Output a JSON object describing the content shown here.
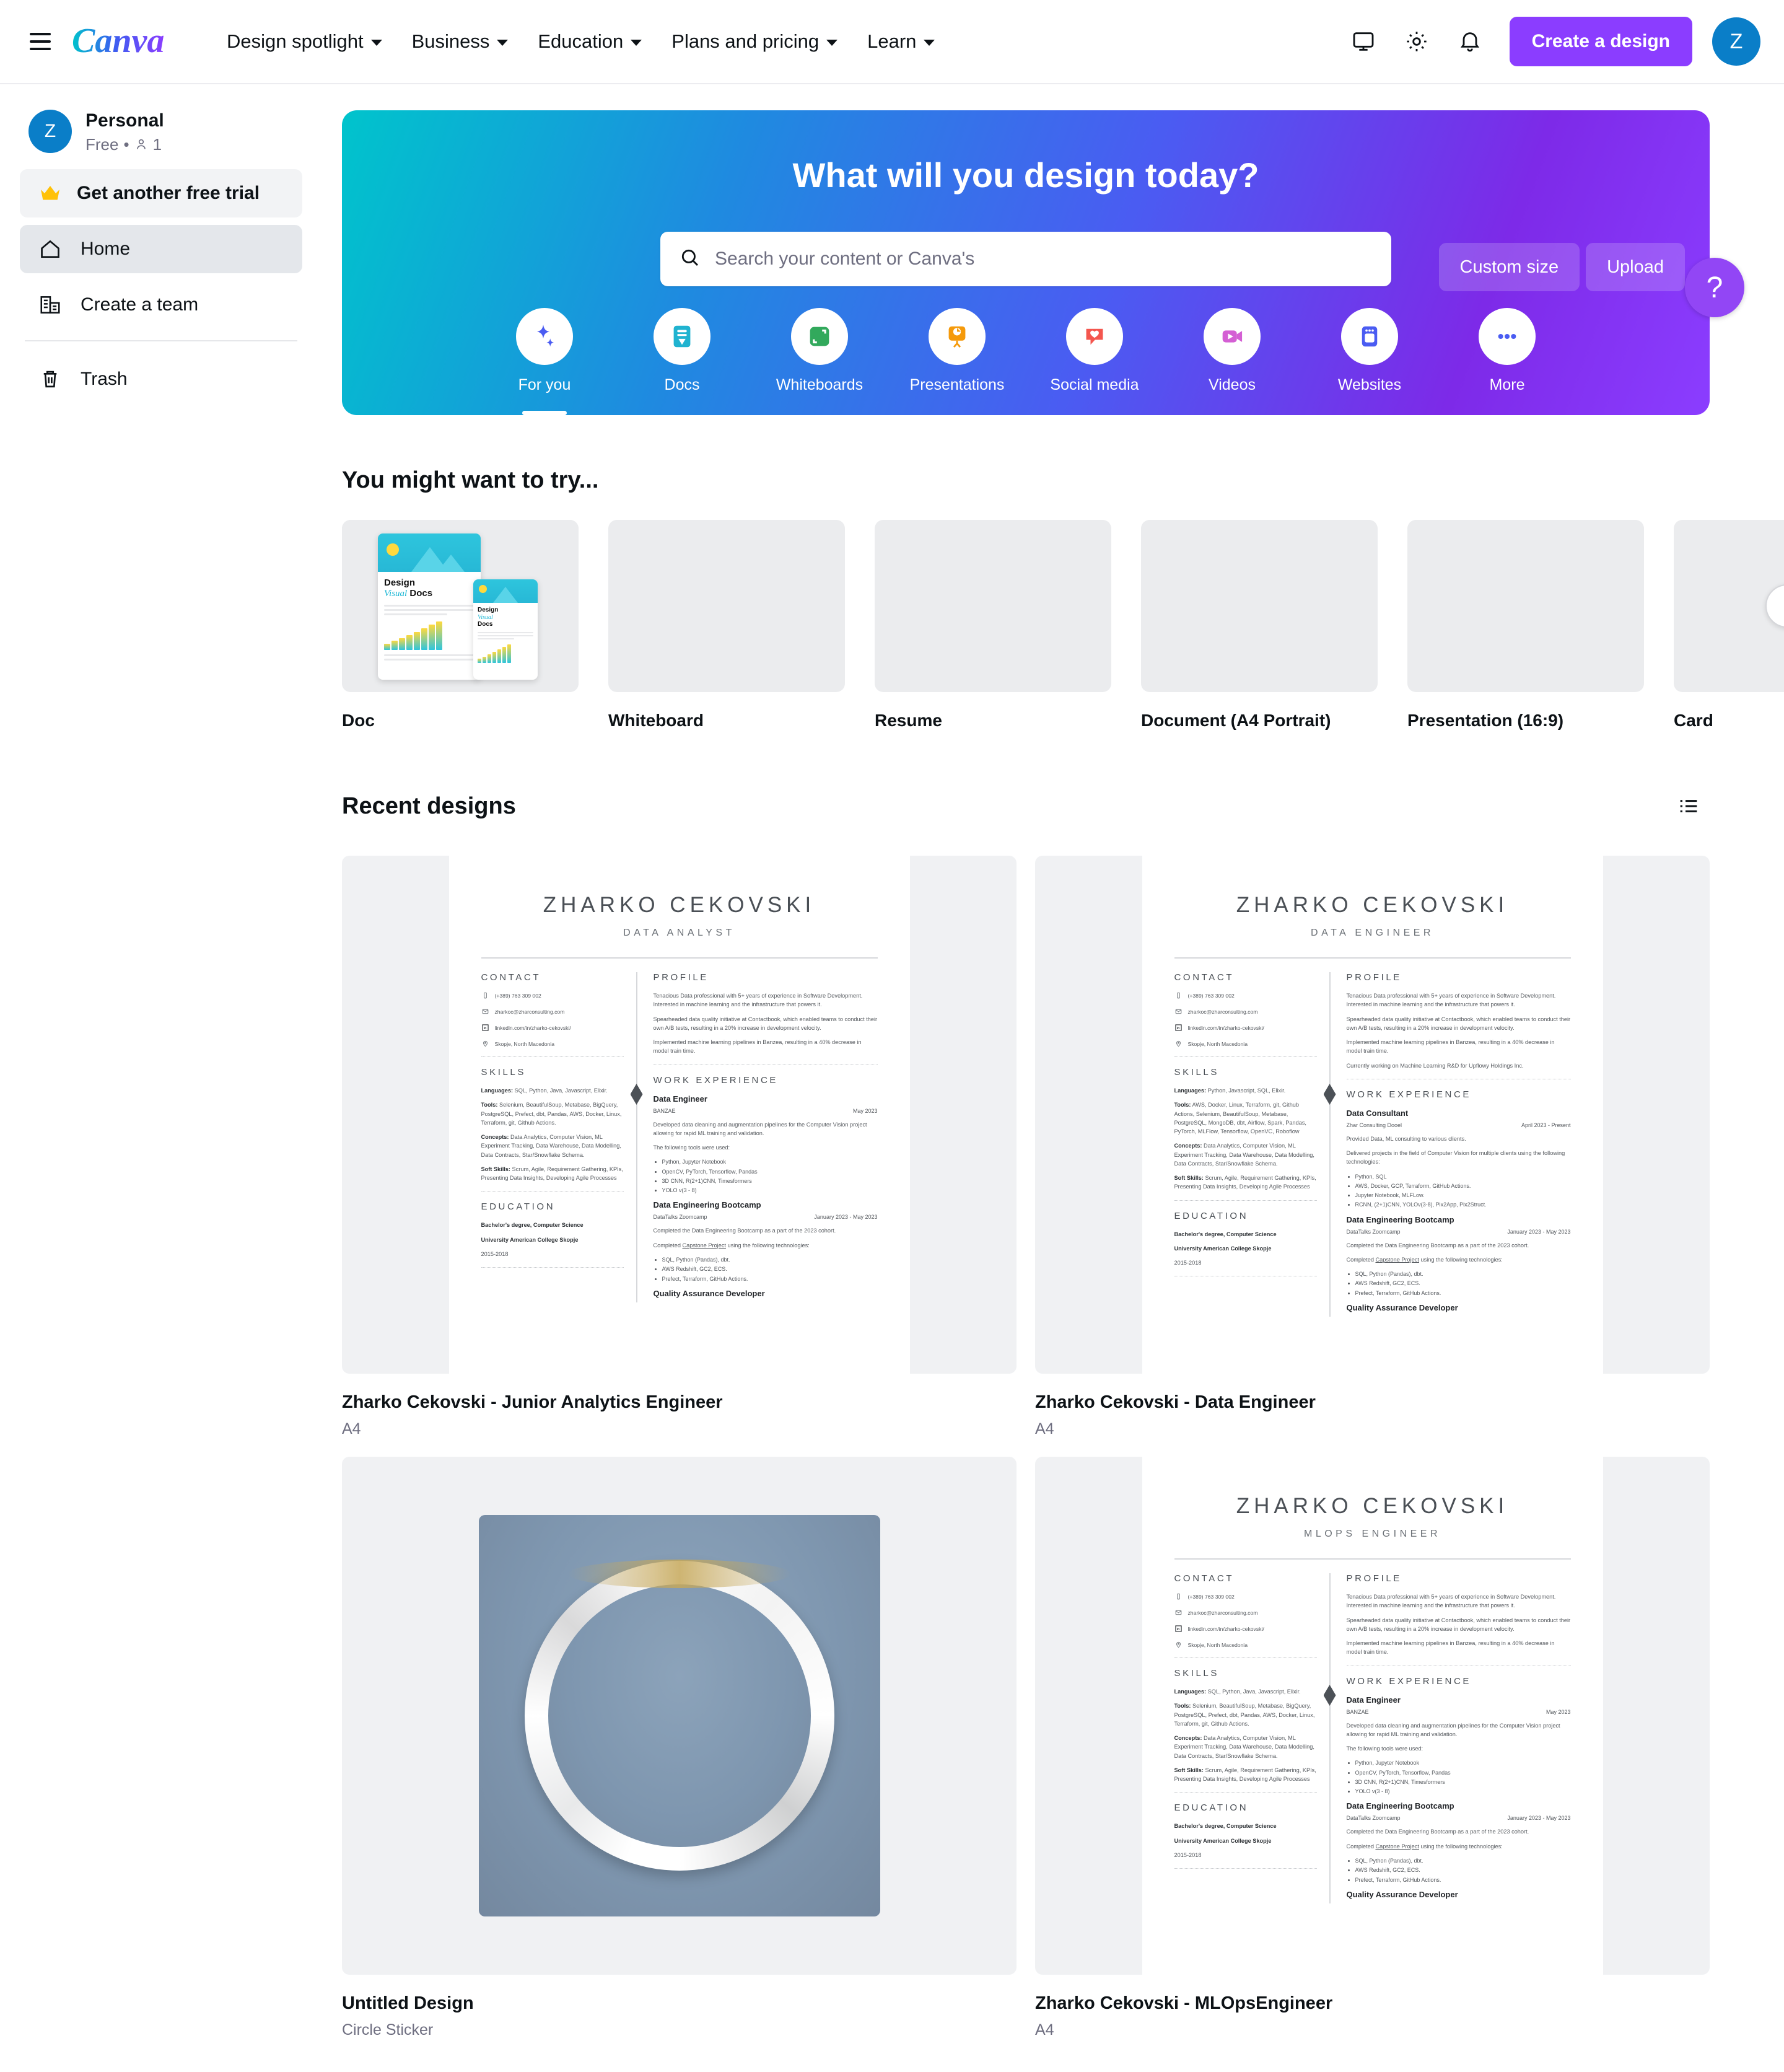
{
  "topnav": {
    "brand": "Canva",
    "menu_icon": "hamburger-icon",
    "links": [
      {
        "label": "Design spotlight"
      },
      {
        "label": "Business"
      },
      {
        "label": "Education"
      },
      {
        "label": "Plans and pricing"
      },
      {
        "label": "Learn"
      }
    ],
    "icons": [
      {
        "name": "monitor-icon"
      },
      {
        "name": "gear-icon"
      },
      {
        "name": "bell-icon"
      }
    ],
    "create_label": "Create a design",
    "avatar_initial": "Z",
    "accent_purple": "#8b3dff",
    "avatar_blue": "#0a7ec8"
  },
  "sidebar": {
    "account": {
      "initial": "Z",
      "name": "Personal",
      "plan": "Free",
      "separator": "•",
      "member_count": "1"
    },
    "items": [
      {
        "label": "Get another free trial",
        "icon": "crown-icon"
      },
      {
        "label": "Home",
        "icon": "home-icon"
      },
      {
        "label": "Create a team",
        "icon": "building-icon"
      },
      {
        "label": "Trash",
        "icon": "trash-icon"
      }
    ]
  },
  "hero": {
    "title": "What will you design today?",
    "custom_size_label": "Custom size",
    "upload_label": "Upload",
    "search_placeholder": "Search your content or Canva's",
    "search_value": "",
    "search_icon": "search-icon",
    "help_label": "?",
    "categories": [
      {
        "label": "For you",
        "icon": "sparkle-icon",
        "color": "#ffffff",
        "selected": true
      },
      {
        "label": "Docs",
        "icon": "doc-icon",
        "color": "#20b3d0",
        "selected": false
      },
      {
        "label": "Whiteboards",
        "icon": "whiteboard-icon",
        "color": "#32a95c",
        "selected": false
      },
      {
        "label": "Presentations",
        "icon": "presentation-icon",
        "color": "#f59a0b",
        "selected": false
      },
      {
        "label": "Social media",
        "icon": "heart-bubble-icon",
        "color": "#f4564e",
        "selected": false
      },
      {
        "label": "Videos",
        "icon": "video-icon",
        "color": "#d45fd4",
        "selected": false
      },
      {
        "label": "Websites",
        "icon": "website-icon",
        "color": "#4a5cf2",
        "selected": false
      },
      {
        "label": "More",
        "icon": "ellipsis-icon",
        "color": "#4a5cf2",
        "selected": false
      }
    ]
  },
  "try_section": {
    "title": "You might want to try...",
    "next_icon": "chevron-right-icon",
    "cards": [
      {
        "label": "Doc",
        "has_preview": true,
        "preview_title_1": "Design",
        "preview_title_2": "Visual",
        "preview_title_3": "Docs"
      },
      {
        "label": "Whiteboard",
        "has_preview": false
      },
      {
        "label": "Resume",
        "has_preview": false
      },
      {
        "label": "Document (A4 Portrait)",
        "has_preview": false
      },
      {
        "label": "Presentation (16:9)",
        "has_preview": false
      },
      {
        "label": "Card",
        "has_preview": false
      }
    ]
  },
  "recent_section": {
    "title": "Recent designs",
    "layout_icon": "list-view-icon",
    "designs": [
      {
        "title": "Zharko Cekovski - Junior Analytics Engineer",
        "meta": "A4",
        "kind": "resume",
        "role": "DATA ANALYST"
      },
      {
        "title": "Zharko Cekovski - Data Engineer",
        "meta": "A4",
        "kind": "resume",
        "role": "DATA ENGINEER"
      },
      {
        "title": "Untitled Design",
        "meta": "Circle Sticker",
        "kind": "sticker"
      },
      {
        "title": " Zharko Cekovski - MLOpsEngineer",
        "meta": "A4",
        "kind": "resume",
        "role": "MLOPS ENGINEER"
      }
    ]
  },
  "resume_common": {
    "name": "ZHARKO CEKOVSKI",
    "contact_heading": "CONTACT",
    "profile_heading": "PROFILE",
    "skills_heading": "SKILLS",
    "work_heading": "WORK EXPERIENCE",
    "education_heading": "EDUCATION",
    "phone": "(+389) 763 309 002",
    "email": "zharkoc@zharconsulting.com",
    "linkedin": "linkedin.com/in/zharko-cekovski/",
    "location": "Skopje, North Macedonia",
    "profile_p1": "Tenacious Data professional with 5+ years of experience in Software Development. Interested in machine learning and the infrastructure that powers it.",
    "profile_p2": "Spearheaded data quality initiative at Contactbook, which enabled teams to conduct their own A/B tests, resulting in a 20% increase in development velocity.",
    "profile_p3": "Implemented machine learning pipelines in Banzea, resulting in a 40% decrease in model train time.",
    "profile_p4": "Currently working on Machine Learning R&D for Upflowy Holdings Inc.",
    "skills_lang_label": "Languages:",
    "skills_lang_a": "SQL, Python, Java, Javascript, Elixir.",
    "skills_lang_b": "Python, Javascript, SQL, Elixir.",
    "skills_tools_label": "Tools:",
    "skills_tools_a": "Selenium, BeautifulSoup, Metabase, BigQuery, PostgreSQL, Prefect, dbt, Pandas, AWS, Docker, Linux, Terraform, git, Github Actions.",
    "skills_tools_b": "AWS, Docker, Linux, Terraform, git, Github Actions, Selenium, BeautifulSoup, Metabase, PostgreSQL, MongoDB, dbt, Airflow, Spark, Pandas, PyTorch, MLFlow, Tensorflow, OpenVC, Roboflow",
    "skills_concepts_label": "Concepts:",
    "skills_concepts": "Data Analytics, Computer Vision, ML Experiment Tracking, Data Warehouse, Data Modelling, Data Contracts, Star/Snowflake Schema.",
    "skills_soft_label": "Soft Skills:",
    "skills_soft": "Scrum, Agile, Requirement Gathering, KPIs, Presenting Data Insights, Developing Agile Processes",
    "edu_degree": "Bachelor's degree, Computer Science",
    "edu_school": "University American College Skopje",
    "edu_years": "2015-2018",
    "job1a_title": "Data Engineer",
    "job1a_company": "BANZAE",
    "job1a_date": "May 2023",
    "job1a_p1": "Developed data cleaning and augmentation pipelines for the Computer Vision project allowing for rapid ML training and validation.",
    "job1a_p2": "The following tools were used:",
    "job1a_bullets": [
      "Python, Jupyter Notebook",
      "OpenCV, PyTorch, Tensorflow, Pandas",
      "3D CNN, R(2+1)CNN, Timesformers",
      "YOLO v(3 - 8)"
    ],
    "job1b_title": "Data Consultant",
    "job1b_company": "Zhar Consulting Dooel",
    "job1b_date": "April 2023 - Present",
    "job1b_p1": "Provided Data, ML consulting to various clients.",
    "job1b_p2": "Delivered projects in the field of Computer Vision for multiple clients using the following technologies:",
    "job1b_bullets": [
      "Python, SQL",
      "AWS, Docker, GCP, Terraform, GitHub Actions.",
      "Jupyter Notebook, MLFLow.",
      "RCNN, (2+1)CNN, YOLOv(3-8), Pix2App, Pix2Struct."
    ],
    "job2_title": "Data Engineering Bootcamp",
    "job2_company": "DataTalks Zoomcamp",
    "job2_date": "January 2023  -  May 2023",
    "job2_p1": "Completed the Data Engineering Bootcamp as a part of the 2023 cohort.",
    "job2_p2_pre": "Completed ",
    "job2_p2_link": "Capstone Project",
    "job2_p2_post": " using the following technologies:",
    "job2_bullets": [
      "SQL, Python (Pandas), dbt.",
      "AWS Redshift, GC2, ECS.",
      "Prefect, Terraform, GitHub Actions."
    ],
    "job3_title": "Quality Assurance Developer"
  }
}
